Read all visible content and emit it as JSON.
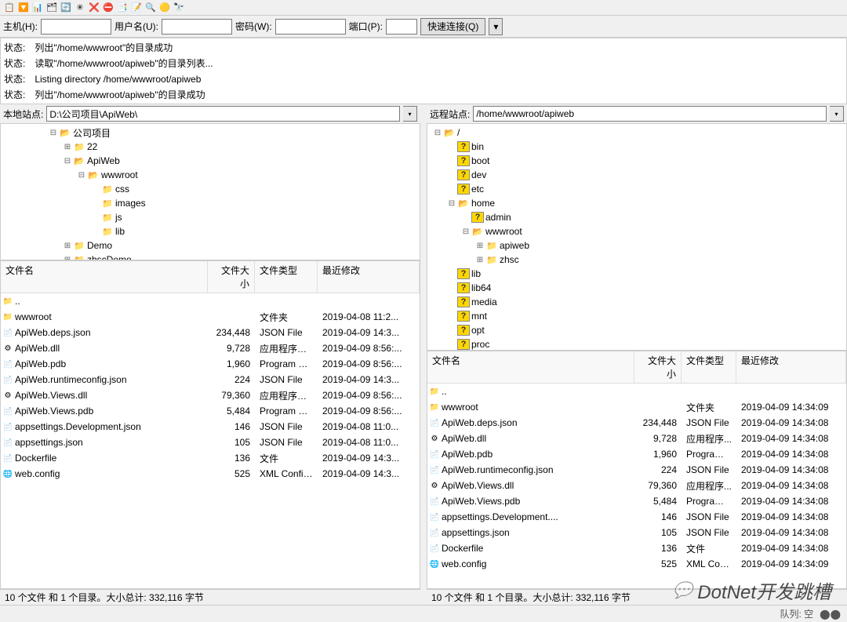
{
  "connection": {
    "host_label": "主机(H):",
    "user_label": "用户名(U):",
    "password_label": "密码(W):",
    "port_label": "端口(P):",
    "quick_connect": "快速连接(Q)"
  },
  "status_log": [
    "状态:　列出\"/home/wwwroot\"的目录成功",
    "状态:　读取\"/home/wwwroot/apiweb\"的目录列表...",
    "状态:　Listing directory /home/wwwroot/apiweb",
    "状态:　列出\"/home/wwwroot/apiweb\"的目录成功"
  ],
  "local": {
    "site_label": "本地站点:",
    "path": "D:\\公司项目\\ApiWeb\\",
    "tree": [
      {
        "indent": 3,
        "exp": "⊟",
        "icon": "folder-open",
        "label": "公司项目"
      },
      {
        "indent": 4,
        "exp": "⊞",
        "icon": "folder",
        "label": "22"
      },
      {
        "indent": 4,
        "exp": "⊟",
        "icon": "folder-open",
        "label": "ApiWeb"
      },
      {
        "indent": 5,
        "exp": "⊟",
        "icon": "folder-open",
        "label": "wwwroot"
      },
      {
        "indent": 6,
        "exp": "",
        "icon": "folder",
        "label": "css"
      },
      {
        "indent": 6,
        "exp": "",
        "icon": "folder",
        "label": "images"
      },
      {
        "indent": 6,
        "exp": "",
        "icon": "folder",
        "label": "js"
      },
      {
        "indent": 6,
        "exp": "",
        "icon": "folder",
        "label": "lib"
      },
      {
        "indent": 4,
        "exp": "⊞",
        "icon": "folder",
        "label": "Demo"
      },
      {
        "indent": 4,
        "exp": "⊞",
        "icon": "folder",
        "label": "zhscDemo"
      }
    ],
    "headers": {
      "name": "文件名",
      "size": "文件大小",
      "type": "文件类型",
      "date": "最近修改"
    },
    "files": [
      {
        "icon": "📁",
        "name": "..",
        "size": "",
        "type": "",
        "date": ""
      },
      {
        "icon": "📁",
        "name": "wwwroot",
        "size": "",
        "type": "文件夹",
        "date": "2019-04-08 11:2..."
      },
      {
        "icon": "📄",
        "name": "ApiWeb.deps.json",
        "size": "234,448",
        "type": "JSON File",
        "date": "2019-04-09 14:3..."
      },
      {
        "icon": "⚙",
        "name": "ApiWeb.dll",
        "size": "9,728",
        "type": "应用程序扩展",
        "date": "2019-04-09 8:56:..."
      },
      {
        "icon": "📄",
        "name": "ApiWeb.pdb",
        "size": "1,960",
        "type": "Program Deb...",
        "date": "2019-04-09 8:56:..."
      },
      {
        "icon": "📄",
        "name": "ApiWeb.runtimeconfig.json",
        "size": "224",
        "type": "JSON File",
        "date": "2019-04-09 14:3..."
      },
      {
        "icon": "⚙",
        "name": "ApiWeb.Views.dll",
        "size": "79,360",
        "type": "应用程序扩展",
        "date": "2019-04-09 8:56:..."
      },
      {
        "icon": "📄",
        "name": "ApiWeb.Views.pdb",
        "size": "5,484",
        "type": "Program Deb...",
        "date": "2019-04-09 8:56:..."
      },
      {
        "icon": "📄",
        "name": "appsettings.Development.json",
        "size": "146",
        "type": "JSON File",
        "date": "2019-04-08 11:0..."
      },
      {
        "icon": "📄",
        "name": "appsettings.json",
        "size": "105",
        "type": "JSON File",
        "date": "2019-04-08 11:0..."
      },
      {
        "icon": "📄",
        "name": "Dockerfile",
        "size": "136",
        "type": "文件",
        "date": "2019-04-09 14:3..."
      },
      {
        "icon": "🌐",
        "name": "web.config",
        "size": "525",
        "type": "XML Configu...",
        "date": "2019-04-09 14:3..."
      }
    ],
    "footer": "10 个文件 和 1 个目录。大小总计: 332,116 字节"
  },
  "remote": {
    "site_label": "远程站点:",
    "path": "/home/wwwroot/apiweb",
    "tree": [
      {
        "indent": 0,
        "exp": "⊟",
        "icon": "folder-open",
        "label": "/"
      },
      {
        "indent": 1,
        "exp": "",
        "icon": "question",
        "label": "bin"
      },
      {
        "indent": 1,
        "exp": "",
        "icon": "question",
        "label": "boot"
      },
      {
        "indent": 1,
        "exp": "",
        "icon": "question",
        "label": "dev"
      },
      {
        "indent": 1,
        "exp": "",
        "icon": "question",
        "label": "etc"
      },
      {
        "indent": 1,
        "exp": "⊟",
        "icon": "folder-open",
        "label": "home"
      },
      {
        "indent": 2,
        "exp": "",
        "icon": "question",
        "label": "admin"
      },
      {
        "indent": 2,
        "exp": "⊟",
        "icon": "folder-open",
        "label": "wwwroot"
      },
      {
        "indent": 3,
        "exp": "⊞",
        "icon": "folder",
        "label": "apiweb"
      },
      {
        "indent": 3,
        "exp": "⊞",
        "icon": "folder",
        "label": "zhsc"
      },
      {
        "indent": 1,
        "exp": "",
        "icon": "question",
        "label": "lib"
      },
      {
        "indent": 1,
        "exp": "",
        "icon": "question",
        "label": "lib64"
      },
      {
        "indent": 1,
        "exp": "",
        "icon": "question",
        "label": "media"
      },
      {
        "indent": 1,
        "exp": "",
        "icon": "question",
        "label": "mnt"
      },
      {
        "indent": 1,
        "exp": "",
        "icon": "question",
        "label": "opt"
      },
      {
        "indent": 1,
        "exp": "",
        "icon": "question",
        "label": "proc"
      }
    ],
    "headers": {
      "name": "文件名",
      "size": "文件大小",
      "type": "文件类型",
      "date": "最近修改"
    },
    "files": [
      {
        "icon": "📁",
        "name": "..",
        "size": "",
        "type": "",
        "date": ""
      },
      {
        "icon": "📁",
        "name": "wwwroot",
        "size": "",
        "type": "文件夹",
        "date": "2019-04-09 14:34:09"
      },
      {
        "icon": "📄",
        "name": "ApiWeb.deps.json",
        "size": "234,448",
        "type": "JSON File",
        "date": "2019-04-09 14:34:08"
      },
      {
        "icon": "⚙",
        "name": "ApiWeb.dll",
        "size": "9,728",
        "type": "应用程序...",
        "date": "2019-04-09 14:34:08"
      },
      {
        "icon": "📄",
        "name": "ApiWeb.pdb",
        "size": "1,960",
        "type": "Program ...",
        "date": "2019-04-09 14:34:08"
      },
      {
        "icon": "📄",
        "name": "ApiWeb.runtimeconfig.json",
        "size": "224",
        "type": "JSON File",
        "date": "2019-04-09 14:34:08"
      },
      {
        "icon": "⚙",
        "name": "ApiWeb.Views.dll",
        "size": "79,360",
        "type": "应用程序...",
        "date": "2019-04-09 14:34:08"
      },
      {
        "icon": "📄",
        "name": "ApiWeb.Views.pdb",
        "size": "5,484",
        "type": "Program ...",
        "date": "2019-04-09 14:34:08"
      },
      {
        "icon": "📄",
        "name": "appsettings.Development....",
        "size": "146",
        "type": "JSON File",
        "date": "2019-04-09 14:34:08"
      },
      {
        "icon": "📄",
        "name": "appsettings.json",
        "size": "105",
        "type": "JSON File",
        "date": "2019-04-09 14:34:08"
      },
      {
        "icon": "📄",
        "name": "Dockerfile",
        "size": "136",
        "type": "文件",
        "date": "2019-04-09 14:34:08"
      },
      {
        "icon": "🌐",
        "name": "web.config",
        "size": "525",
        "type": "XML Conf...",
        "date": "2019-04-09 14:34:09"
      }
    ],
    "footer": "10 个文件 和 1 个目录。大小总计: 332,116 字节"
  },
  "bottom": {
    "queue": "队列: 空"
  },
  "watermark": "DotNet开发跳槽"
}
